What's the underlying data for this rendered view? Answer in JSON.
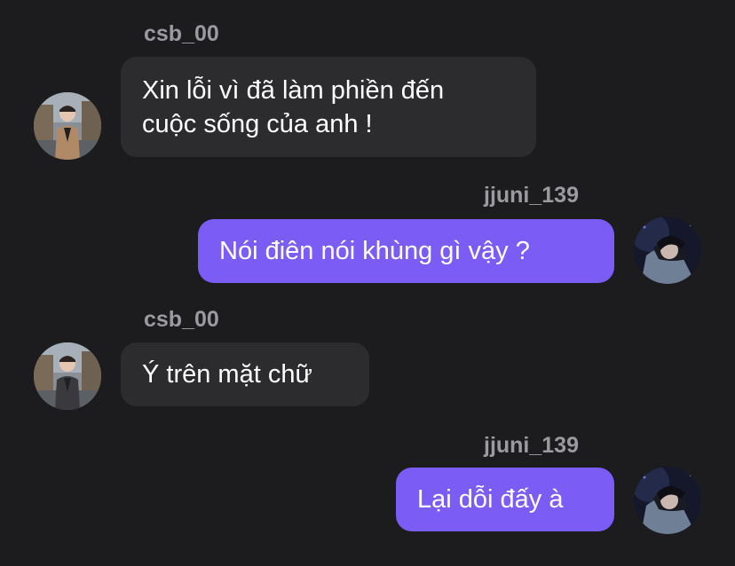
{
  "messages": [
    {
      "sender": "csb_00",
      "direction": "incoming",
      "text": "Xin lỗi vì đã làm phiền đến\ncuộc sống của anh !"
    },
    {
      "sender": "jjuni_139",
      "direction": "outgoing",
      "text": "Nói điên nói khùng gì vậy ?"
    },
    {
      "sender": "csb_00",
      "direction": "incoming",
      "text": "Ý trên mặt chữ"
    },
    {
      "sender": "jjuni_139",
      "direction": "outgoing",
      "text": "Lại dỗi đấy à"
    }
  ],
  "colors": {
    "background": "#1c1c1e",
    "incoming_bubble": "#2c2c2e",
    "outgoing_bubble": "#7b5cf5",
    "username": "#9a9a9f",
    "text": "#ffffff"
  },
  "icons": {
    "incoming_avatar": "avatar-photo-person-outdoor",
    "outgoing_avatar": "avatar-photo-dark-portrait"
  }
}
